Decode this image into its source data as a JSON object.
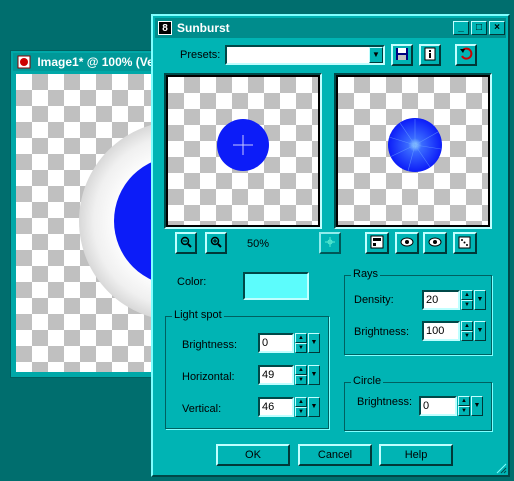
{
  "background_window": {
    "title": "Image1* @ 100% (Ve",
    "colors": {
      "ring": "#ffffff",
      "disc": "#0c1cf8"
    }
  },
  "dialog": {
    "title": "Sunburst",
    "title_icon_text": "8",
    "title_buttons": {
      "minimize": "_",
      "maximize": "□",
      "close": "×"
    },
    "presets": {
      "label": "Presets:",
      "value": ""
    },
    "preview": {
      "zoom_label": "50%"
    },
    "color": {
      "label": "Color:",
      "value": "#5cfcfc"
    },
    "light_spot": {
      "group_label": "Light spot",
      "brightness": {
        "label": "Brightness:",
        "value": "0"
      },
      "horizontal": {
        "label": "Horizontal:",
        "value": "49"
      },
      "vertical": {
        "label": "Vertical:",
        "value": "46"
      }
    },
    "rays": {
      "group_label": "Rays",
      "density": {
        "label": "Density:",
        "value": "20"
      },
      "brightness": {
        "label": "Brightness:",
        "value": "100"
      }
    },
    "circle": {
      "group_label": "Circle",
      "brightness": {
        "label": "Brightness:",
        "value": "0"
      }
    },
    "buttons": {
      "ok": "OK",
      "cancel": "Cancel",
      "help": "Help"
    },
    "colors": {
      "dialog_bg": "#00b4b4",
      "title_bg": "#008c8c",
      "circle_fill": "#0c1cf8"
    }
  }
}
